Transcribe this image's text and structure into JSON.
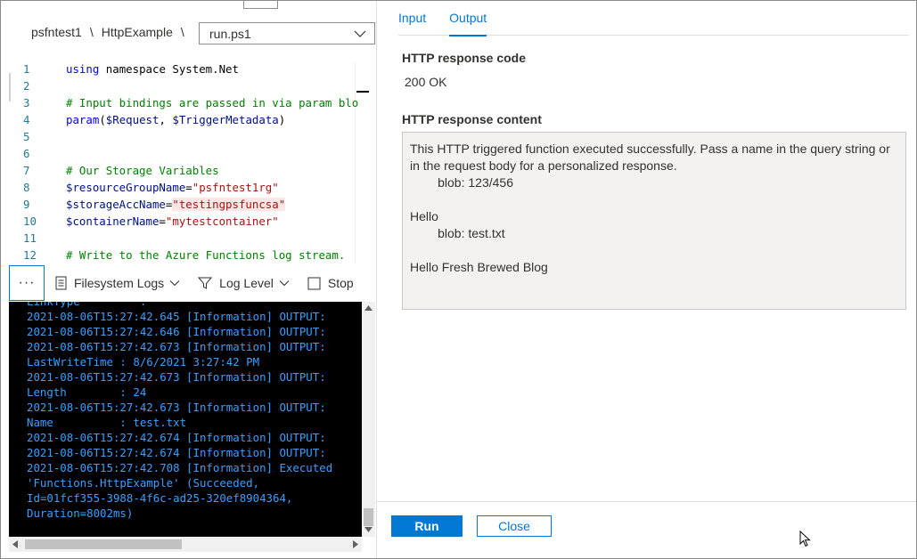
{
  "breadcrumb": {
    "items": [
      "psfntest1",
      "HttpExample"
    ],
    "separator": "\\"
  },
  "file_select": {
    "value": "run.ps1"
  },
  "editor": {
    "lines": [
      {
        "num": "1",
        "segments": [
          {
            "t": "using",
            "c": "kw"
          },
          {
            "t": " namespace System.Net",
            "c": ""
          }
        ]
      },
      {
        "num": "2",
        "segments": []
      },
      {
        "num": "3",
        "segments": [
          {
            "t": "# Input bindings are passed in via param blo",
            "c": "cm"
          }
        ]
      },
      {
        "num": "4",
        "segments": [
          {
            "t": "param",
            "c": "kw"
          },
          {
            "t": "(",
            "c": ""
          },
          {
            "t": "$Request",
            "c": "var"
          },
          {
            "t": ", ",
            "c": ""
          },
          {
            "t": "$TriggerMetadata",
            "c": "var"
          },
          {
            "t": ")",
            "c": ""
          }
        ]
      },
      {
        "num": "5",
        "segments": []
      },
      {
        "num": "6",
        "segments": []
      },
      {
        "num": "7",
        "segments": [
          {
            "t": "# Our Storage Variables",
            "c": "cm"
          }
        ]
      },
      {
        "num": "8",
        "segments": [
          {
            "t": "$resourceGroupName",
            "c": "var"
          },
          {
            "t": "=",
            "c": ""
          },
          {
            "t": "\"psfntest1rg\"",
            "c": "str"
          }
        ]
      },
      {
        "num": "9",
        "segments": [
          {
            "t": "$storageAccName",
            "c": "var"
          },
          {
            "t": "=",
            "c": ""
          },
          {
            "t": "\"testingpsfuncsa\"",
            "c": "str hl"
          }
        ]
      },
      {
        "num": "10",
        "segments": [
          {
            "t": "$containerName",
            "c": "var"
          },
          {
            "t": "=",
            "c": ""
          },
          {
            "t": "\"mytestcontainer\"",
            "c": "str"
          }
        ]
      },
      {
        "num": "11",
        "segments": []
      },
      {
        "num": "12",
        "segments": [
          {
            "t": "# Write to the Azure Functions log stream.",
            "c": "cm"
          }
        ]
      }
    ]
  },
  "toolbar": {
    "more_label": "···",
    "filesystem_logs": "Filesystem Logs",
    "log_level": "Log Level",
    "stop": "Stop"
  },
  "console": {
    "lines": [
      "LinkType         :",
      "2021-08-06T15:27:42.645 [Information] OUTPUT:",
      "2021-08-06T15:27:42.646 [Information] OUTPUT:",
      "2021-08-06T15:27:42.673 [Information] OUTPUT:",
      "LastWriteTime : 8/6/2021 3:27:42 PM",
      "2021-08-06T15:27:42.673 [Information] OUTPUT:",
      "Length        : 24",
      "2021-08-06T15:27:42.673 [Information] OUTPUT:",
      "Name          : test.txt",
      "2021-08-06T15:27:42.674 [Information] OUTPUT:",
      "2021-08-06T15:27:42.674 [Information] OUTPUT:",
      "2021-08-06T15:27:42.708 [Information] Executed",
      "'Functions.HttpExample' (Succeeded,",
      "Id=01fcf355-3988-4f6c-ad25-320ef8904364,",
      "Duration=8002ms)"
    ]
  },
  "panel": {
    "tabs": [
      {
        "label": "Input",
        "active": false
      },
      {
        "label": "Output",
        "active": true
      }
    ],
    "response_code_label": "HTTP response code",
    "response_code_value": "200 OK",
    "response_content_label": "HTTP response content",
    "response_content_lines": [
      "This HTTP triggered function executed successfully. Pass a name in the query string or in the request body for a personalized response.",
      "        blob: 123/456",
      "",
      "Hello",
      "        blob: test.txt",
      "",
      "Hello Fresh Brewed Blog"
    ]
  },
  "footer": {
    "run_label": "Run",
    "close_label": "Close"
  },
  "colors": {
    "accent": "#0078d4",
    "console_bg": "#000000",
    "console_text": "#3ba0ff",
    "content_bg": "#f3f2f1"
  }
}
